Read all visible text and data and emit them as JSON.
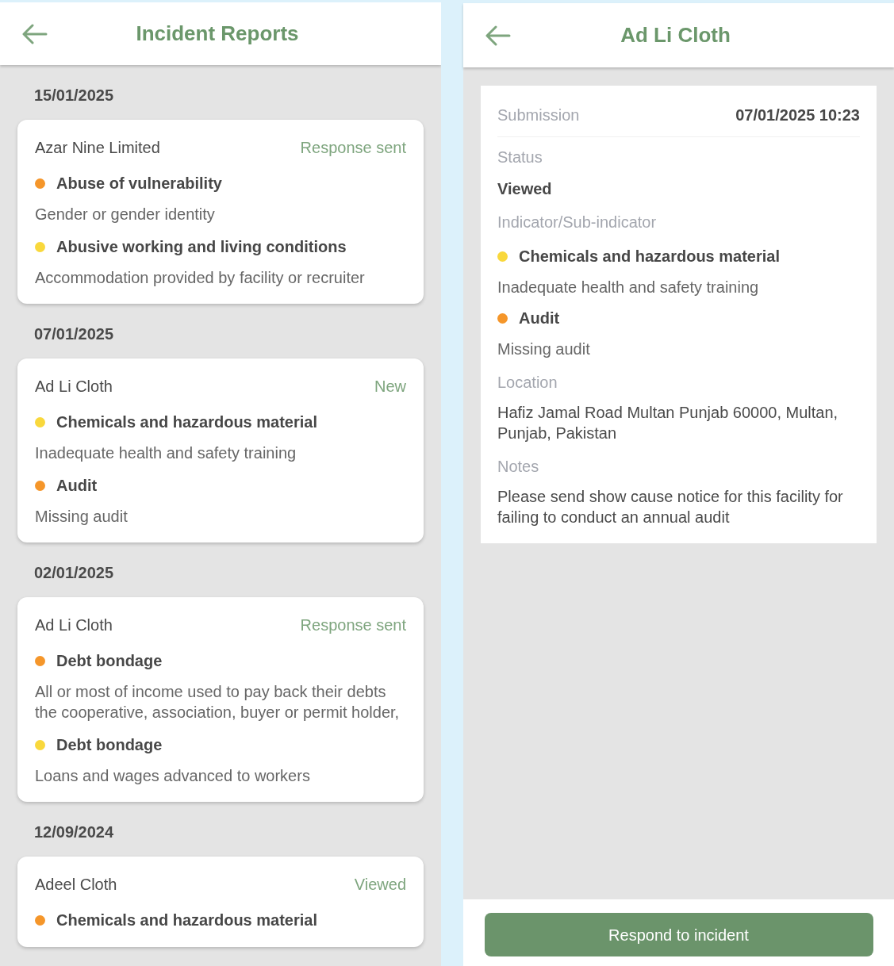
{
  "list_screen": {
    "title": "Incident Reports",
    "groups": [
      {
        "date": "15/01/2025",
        "reports": [
          {
            "facility": "Azar Nine Limited",
            "status": "Response sent",
            "indicators": [
              {
                "name": "Abuse of vulnerability",
                "color": "#f5962a",
                "detail": "Gender or gender identity"
              },
              {
                "name": "Abusive working and living conditions",
                "color": "#f9d83c",
                "detail": "Accommodation provided by facility or recruiter"
              }
            ]
          }
        ]
      },
      {
        "date": "07/01/2025",
        "reports": [
          {
            "facility": "Ad Li Cloth",
            "status": "New",
            "indicators": [
              {
                "name": "Chemicals and hazardous material",
                "color": "#f9d83c",
                "detail": "Inadequate health and safety training"
              },
              {
                "name": "Audit",
                "color": "#f5962a",
                "detail": "Missing audit"
              }
            ]
          }
        ]
      },
      {
        "date": "02/01/2025",
        "reports": [
          {
            "facility": "Ad Li Cloth",
            "status": "Response sent",
            "indicators": [
              {
                "name": "Debt bondage",
                "color": "#f5962a",
                "detail": "All or most of income used to pay back their debts the cooperative, association, buyer or permit holder,"
              },
              {
                "name": "Debt bondage",
                "color": "#f9d83c",
                "detail": "Loans and wages advanced to workers"
              }
            ]
          }
        ]
      },
      {
        "date": "12/09/2024",
        "reports": [
          {
            "facility": "Adeel Cloth",
            "status": "Viewed",
            "indicators": [
              {
                "name": "Chemicals and hazardous material",
                "color": "#f5962a"
              }
            ]
          }
        ]
      }
    ]
  },
  "detail_screen": {
    "title": "Ad Li Cloth",
    "submission": {
      "label": "Submission",
      "value": "07/01/2025 10:23"
    },
    "status": {
      "label": "Status",
      "value": "Viewed"
    },
    "indicators_label": "Indicator/Sub-indicator",
    "indicators": [
      {
        "name": "Chemicals and hazardous material",
        "color": "#f9d83c",
        "detail": "Inadequate health and safety training"
      },
      {
        "name": "Audit",
        "color": "#f5962a",
        "detail": "Missing audit"
      }
    ],
    "location": {
      "label": "Location",
      "value": "Hafiz Jamal Road Multan Punjab 60000, Multan, Punjab, Pakistan"
    },
    "notes": {
      "label": "Notes",
      "value": "Please send show cause notice for this facility for failing to conduct an annual audit"
    },
    "button": "Respond to incident"
  }
}
